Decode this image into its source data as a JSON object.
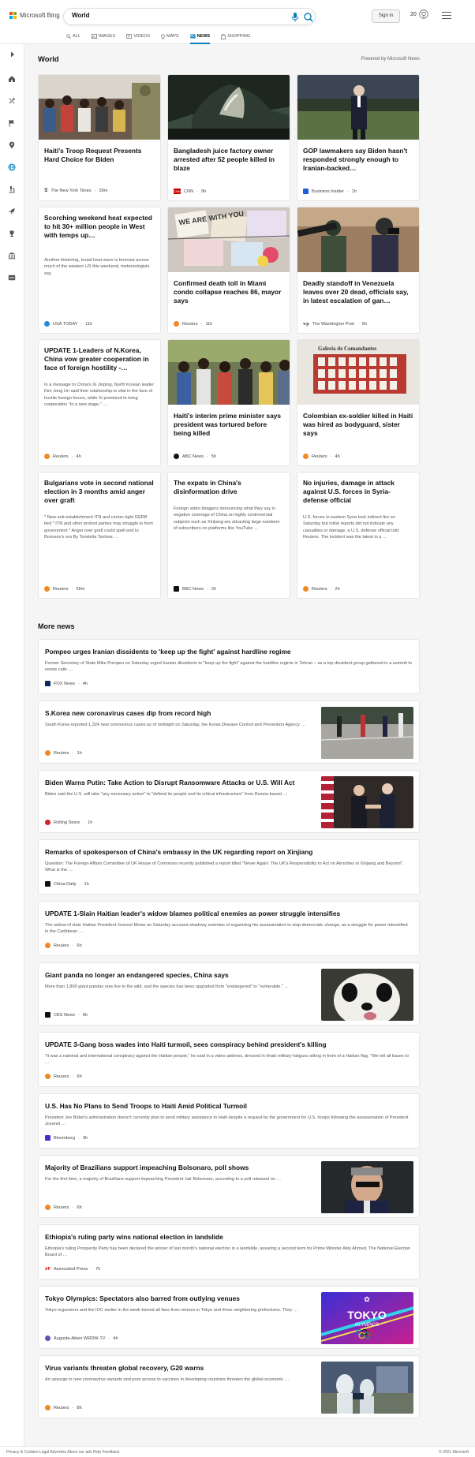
{
  "header": {
    "logo_text": "Microsoft Bing",
    "search_value": "World",
    "signin_label": "Sign in",
    "rewards_count": "20"
  },
  "nav": [
    "ALL",
    "IMAGES",
    "VIDEOS",
    "MAPS",
    "NEWS",
    "SHOPPING"
  ],
  "section": {
    "title": "World",
    "powered": "Powered by Microsoft News"
  },
  "cards": [
    {
      "title": "Haiti's Troop Request Presents Hard Choice for Biden",
      "source": "The New York Times",
      "time": "39m"
    },
    {
      "title": "Bangladesh juice factory owner arrested after 52 people killed in blaze",
      "source": "CNN",
      "time": "9h"
    },
    {
      "title": "GOP lawmakers say Biden hasn't responded strongly enough to Iranian-backed…",
      "source": "Business Insider",
      "time": "1h"
    },
    {
      "title": "Scorching weekend heat expected to hit 30+ million people in West with temps up…",
      "snippet": "Another blistering, brutal heat wave is forecast across much of the western US this weekend, meteorologists say.",
      "source": "USA TODAY",
      "time": "11h"
    },
    {
      "title": "Confirmed death toll in Miami condo collapse reaches 86, mayor says",
      "source": "Reuters",
      "time": "11h",
      "img_text": "WE ARE WITH YOU"
    },
    {
      "title": "Deadly standoff in Venezuela leaves over 20 dead, officials say, in latest escalation of gan…",
      "source": "The Washington Post",
      "time": "5h"
    },
    {
      "title": "UPDATE 1-Leaders of N.Korea, China vow greater cooperation in face of foreign hostility -…",
      "snippet": "In a message to China's Xi Jinping, North Korean leader Kim Jong Un said their relationship is vital in the face of hostile foreign forces, while Xi promised to bring cooperation \"to a new stage,\" …",
      "source": "Reuters",
      "time": "4h"
    },
    {
      "title": "Haiti's interim prime minister says president was tortured before being killed",
      "source": "ABC News",
      "time": "5h"
    },
    {
      "title": "Colombian ex-soldier killed in Haiti was hired as bodyguard, sister says",
      "source": "Reuters",
      "time": "4h",
      "img_text": "Galeria de Comandantes"
    },
    {
      "title": "Bulgarians vote in second national election in 3 months amid anger over graft",
      "snippet": "* New anti-establishment ITN and center-right GERB tied * ITN and other protest parties may struggle to form government * Anger over graft could spell end to Borissov's era By Tsvetelia Tsolova …",
      "source": "Reuters",
      "time": "56m"
    },
    {
      "title": "The expats in China's disinformation drive",
      "snippet": "Foreign video bloggers denouncing what they say is negative coverage of China on highly controversial subjects such as Xinjiang are attracting large numbers of subscribers on platforms like YouTube …",
      "source": "BBC News",
      "time": "2h"
    },
    {
      "title": "No injuries, damage in attack against U.S. forces in Syria-defense official",
      "snippet": "U.S. forces in eastern Syria took indirect fire on Saturday but initial reports did not indicate any casualties or damage, a U.S. defense official told Reuters. The incident was the latest in a …",
      "source": "Reuters",
      "time": "2h"
    }
  ],
  "more_news_title": "More news",
  "more": [
    {
      "title": "Pompeo urges Iranian dissidents to 'keep up the fight' against hardline regime",
      "snippet": "Former Secretary of State Mike Pompeo on Saturday urged Iranian dissidents to \"keep up the fight\" against the hardline regime in Tehran – as a top dissident group gathered in a summit to renew calls …",
      "source": "FOX News",
      "time": "4h"
    },
    {
      "title": "S.Korea new coronavirus cases dip from record high",
      "snippet": "South Korea reported 1,324 new coronavirus cases as of midnight on Saturday, the Korea Disease Control and Prevention Agency …",
      "source": "Reuters",
      "time": "1h"
    },
    {
      "title": "Biden Warns Putin: Take Action to Disrupt Ransomware Attacks or U.S. Will Act",
      "snippet": "Biden said the U.S. will take \"any necessary action\" to \"defend its people and its critical infrastructure\" from Russia-based …",
      "source": "Rolling Stone",
      "time": "1h"
    },
    {
      "title": "Remarks of spokesperson of China's embassy in the UK regarding report on Xinjiang",
      "snippet": "Question: The Foreign Affairs Committee of UK House of Commons recently published a report titled \"Never Again: The UK's Responsibility to Act on Atrocities in Xinjiang and Beyond\". What is the …",
      "source": "China Daily",
      "time": "1h"
    },
    {
      "title": "UPDATE 1-Slain Haitian leader's widow blames political enemies as power struggle intensifies",
      "snippet": "The widow of slain Haitian President Jovenel Moise on Saturday accused shadowy enemies of organizing his assassination to stop democratic change, as a struggle for power intensified in the Caribbean …",
      "source": "Reuters",
      "time": "6h"
    },
    {
      "title": "Giant panda no longer an endangered species, China says",
      "snippet": "More than 1,800 giant pandas now live in the wild, and the species has been upgraded from \"endangered\" to \"vulnerable.\" …",
      "source": "CBS News",
      "time": "6h"
    },
    {
      "title": "UPDATE 3-Gang boss wades into Haiti turmoil, sees conspiracy behind president's killing",
      "snippet": "\"It was a national and international conspiracy against the Haitian people,\" he said in a video address, dressed in khaki military fatigues sitting in front of a Haitian flag. \"We tell all bases to …",
      "source": "Reuters",
      "time": "6h"
    },
    {
      "title": "U.S. Has No Plans to Send Troops to Haiti Amid Political Turmoil",
      "snippet": "President Joe Biden's administration doesn't currently plan to send military assistance to Haiti despite a request by the government for U.S. troops following the assassination of President Jovenel …",
      "source": "Bloomberg",
      "time": "3h"
    },
    {
      "title": "Majority of Brazilians support impeaching Bolsonaro, poll shows",
      "snippet": "For the first time, a majority of Brazilians support impeaching President Jair Bolsonaro, according to a poll released on …",
      "source": "Reuters",
      "time": "6h"
    },
    {
      "title": "Ethiopia's ruling party wins national election in landslide",
      "snippet": "Ethiopia's ruling Prosperity Party has been declared the winner of last month's national election in a landslide, assuring a second term for Prime Minister Abiy Ahmed. The National Election Board of …",
      "source": "Associated Press",
      "time": "7h"
    },
    {
      "title": "Tokyo Olympics: Spectators also barred from outlying venues",
      "snippet": "Tokyo organizers and the IOC earlier in the week barred all fans from venues in Tokyo and three neighboring prefectures. They …",
      "source": "Augusta-Aiken WRDW-TV",
      "time": "4h",
      "img_text": "TOKYO",
      "img_text2": "OLYMPICS"
    },
    {
      "title": "Virus variants threaten global recovery, G20 warns",
      "snippet": "An upsurge in new coronavirus variants and poor access to vaccines in developing countries threaten the global economic …",
      "source": "Reuters",
      "time": "8h"
    }
  ],
  "footer": {
    "left": "Privacy & Cookies   Legal   Advertise   About our ads   Help   Feedback",
    "right": "© 2021 Microsoft"
  }
}
